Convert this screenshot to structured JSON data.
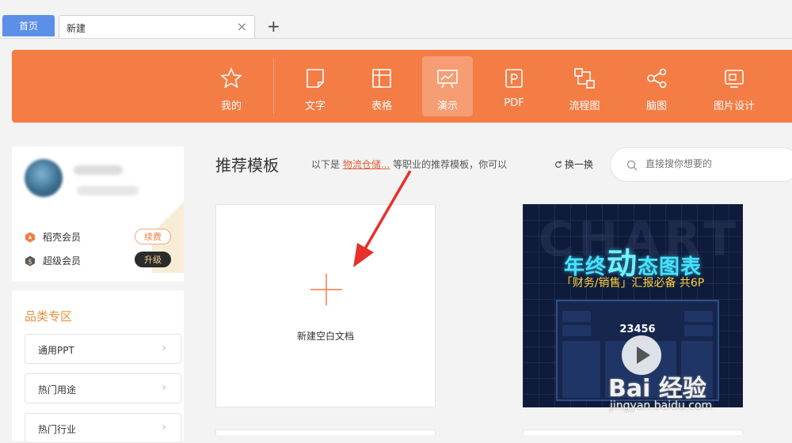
{
  "tabs": {
    "home": "首页",
    "current": "新建",
    "close": "×",
    "add": "+"
  },
  "toolbar": {
    "items": [
      {
        "label": "我的",
        "icon": "star-icon"
      },
      {
        "label": "文字",
        "icon": "document-icon"
      },
      {
        "label": "表格",
        "icon": "table-icon"
      },
      {
        "label": "演示",
        "icon": "presentation-icon",
        "active": true
      },
      {
        "label": "PDF",
        "icon": "pdf-icon"
      },
      {
        "label": "流程图",
        "icon": "flowchart-icon"
      },
      {
        "label": "脑图",
        "icon": "mindmap-icon"
      },
      {
        "label": "图片设计",
        "icon": "image-design-icon"
      }
    ]
  },
  "user": {
    "membership": [
      {
        "name": "稻壳会员",
        "action": "续费",
        "icon": "shell-icon",
        "color": "#f47c45"
      },
      {
        "name": "超级会员",
        "action": "升级",
        "icon": "super-member-icon",
        "color": "#5a5a5a"
      }
    ]
  },
  "category": {
    "title": "品类专区",
    "items": [
      {
        "label": "通用PPT"
      },
      {
        "label": "热门用途"
      },
      {
        "label": "热门行业"
      }
    ]
  },
  "recommend": {
    "title": "推荐模板",
    "desc_prefix": "以下是",
    "desc_link": "物流仓储...",
    "desc_suffix": "等职业的推荐模板，你可以",
    "swap": "换一换",
    "search_placeholder": "直接搜你想要的"
  },
  "cards": {
    "blank_label": "新建空白文档",
    "template": {
      "ghost": "CHART",
      "title_a": "年终",
      "title_big": "动",
      "title_b": "态图表",
      "subtitle": "「财务/销售」汇报必备  共6P",
      "screen_value": "23456"
    }
  },
  "watermark": {
    "brand": "Bai 经验",
    "url": "jingyan.baidu.com"
  },
  "colors": {
    "accent": "#f47c45",
    "tab_home": "#5b8fe8",
    "link": "#e35d3a"
  }
}
